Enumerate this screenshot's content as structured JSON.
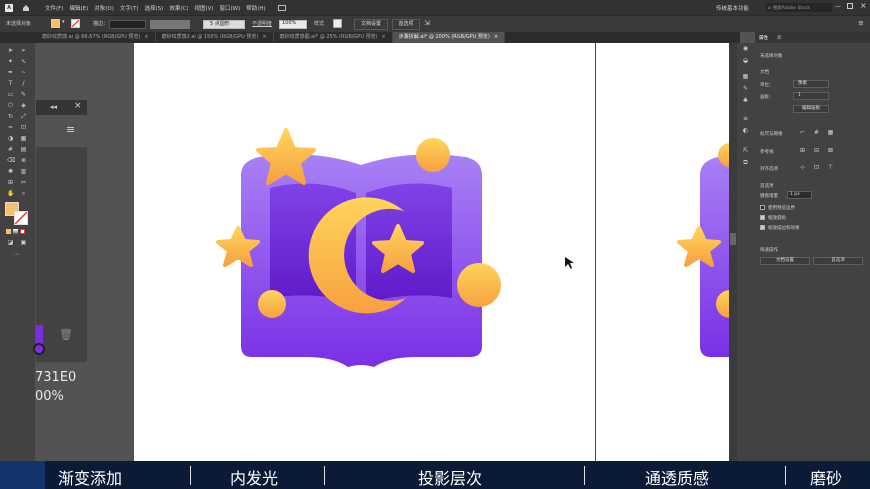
{
  "menu": {
    "items": [
      "文件(F)",
      "编辑(E)",
      "对象(O)",
      "文字(T)",
      "选择(S)",
      "效果(C)",
      "视图(V)",
      "窗口(W)",
      "帮助(H)"
    ],
    "workspace": "传统基本功能",
    "search_placeholder": "搜索Adobe Stock"
  },
  "toolbar": {
    "no_selection": "未选择对象",
    "stroke_label": "描边：",
    "stroke_value": "",
    "point_label": "5 点圆形",
    "opacity_label": "不透明度",
    "opacity_value": "100%",
    "style_label": "样式",
    "doc_setup": "文档设置",
    "prefs": "首选项"
  },
  "tabs": [
    {
      "label": "磨砂纹质感.ai @ 66.67% (RGB/GPU 预览)",
      "active": false
    },
    {
      "label": "磨砂纹质感2.ai @ 150% (RGB/GPU 预览)",
      "active": false
    },
    {
      "label": "磨砂纹质感图.ai* @ 25% (RGB/GPU 预览)",
      "active": false
    },
    {
      "label": "步骤拆解.ai* @ 200% (RGB/GPU 预览)",
      "active": true
    }
  ],
  "left_overlay": {
    "hex_fragment": "731E0",
    "percent_fragment": "00%"
  },
  "props": {
    "tab_props": "属性",
    "tab_libs": "库",
    "no_selection": "未选择对象",
    "document": "文档",
    "units": "像素",
    "artboard_value": "1",
    "edit_artboard": "编辑画板",
    "rulers_grids": "标尺与网格",
    "guides": "参考线",
    "snap": "对齐选项",
    "preferences": "首选项",
    "keyboard_increment_label": "键盘增量",
    "keyboard_increment_value": "1 px",
    "use_preview_bounds": "使用预览边界",
    "scale_corners": "缩放圆角",
    "scale_strokes": "缩放描边和效果",
    "quick_actions": "快速操作",
    "doc_setup_btn": "文档设置",
    "prefs_btn": "首选项"
  },
  "subtitles": [
    "渐变添加",
    "内发光",
    "投影层次",
    "通透质感",
    "磨砂"
  ],
  "colors": {
    "book_top": "#a881f5",
    "book_bottom": "#7a2fe6",
    "gold_top": "#ffd45c",
    "gold_bottom": "#f7a13f",
    "inner_page": "#6b1fd4"
  }
}
